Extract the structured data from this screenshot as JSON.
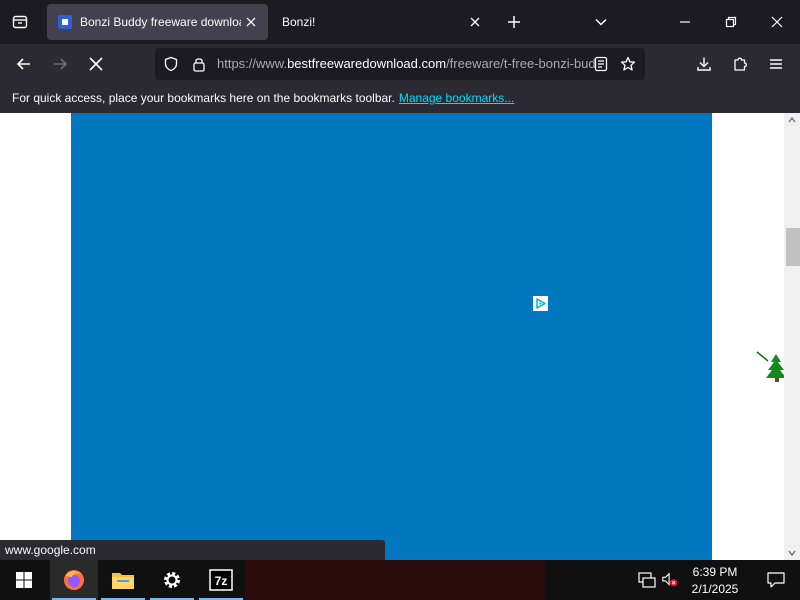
{
  "browser": {
    "tabs": [
      {
        "title": "Bonzi Buddy freeware download",
        "active": true
      },
      {
        "title": "Bonzi!",
        "active": false
      }
    ],
    "url": {
      "prefix": "https://www.",
      "domain": "bestfreewaredownload.com",
      "path": "/freeware/t-free-bonzi-buddy.html"
    },
    "bookmarks_bar": {
      "message": "For quick access, place your bookmarks here on the bookmarks toolbar.",
      "link": "Manage bookmarks..."
    },
    "status_url": "www.google.com"
  },
  "page": {
    "ad_color": "#0077be"
  },
  "taskbar": {
    "apps": [
      {
        "name": "firefox",
        "running": true,
        "active": true
      },
      {
        "name": "file-explorer",
        "running": true,
        "active": false
      },
      {
        "name": "settings",
        "running": true,
        "active": false
      },
      {
        "name": "7-zip",
        "running": true,
        "active": false
      }
    ],
    "time": "6:39 PM",
    "date": "2/1/2025"
  },
  "colors": {
    "accent": "#00ddff",
    "tab_strip": "#1c1b22",
    "toolbar": "#2b2a33",
    "active_tab": "#42414d"
  }
}
